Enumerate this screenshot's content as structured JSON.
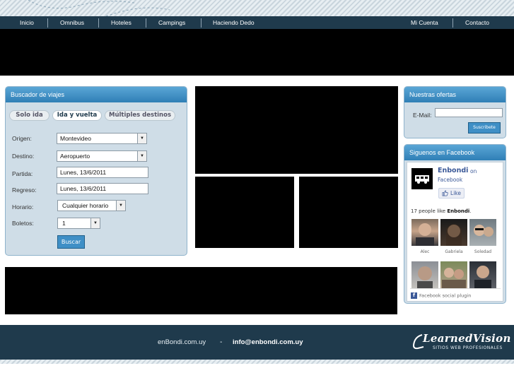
{
  "nav": {
    "items": [
      {
        "label": "Inicio"
      },
      {
        "label": "Omnibus"
      },
      {
        "label": "Hoteles"
      },
      {
        "label": "Campings"
      },
      {
        "label": "Haciendo Dedo"
      }
    ],
    "right_items": [
      {
        "label": "Mi Cuenta"
      },
      {
        "label": "Contacto"
      }
    ]
  },
  "search": {
    "title": "Buscador de viajes",
    "tabs": [
      {
        "label": "Solo ida",
        "active": false
      },
      {
        "label": "Ida y vuelta",
        "active": true
      },
      {
        "label": "Múltiples destinos",
        "active": false
      }
    ],
    "origen": {
      "label": "Origen:",
      "value": "Montevideo"
    },
    "destino": {
      "label": "Destino:",
      "value": "Aeropuerto"
    },
    "partida": {
      "label": "Partida:",
      "value": "Lunes, 13/6/2011"
    },
    "regreso": {
      "label": "Regreso:",
      "value": "Lunes, 13/6/2011"
    },
    "horario": {
      "label": "Horario:",
      "value": "Cualquier horario"
    },
    "boletos": {
      "label": "Boletos:",
      "value": "1"
    },
    "button": "Buscar"
  },
  "offers": {
    "title": "Nuestras ofertas",
    "email_label": "E-Mail:",
    "email_value": "",
    "button": "Suscribete"
  },
  "facebook": {
    "title": "Siguenos en Facebook",
    "page_name": "Enbondi",
    "on_text": "on",
    "facebook_text": "Facebook",
    "like_button": "Like",
    "likes_prefix": "17 people like",
    "likes_page": "Enbondi",
    "likes_suffix": ".",
    "people": [
      {
        "name": "Alec"
      },
      {
        "name": "Gabriela"
      },
      {
        "name": "Soledad"
      },
      {
        "name": ""
      },
      {
        "name": ""
      },
      {
        "name": ""
      }
    ],
    "plugin_text": "Facebook social plugin"
  },
  "footer": {
    "site": "enBondi.com.uy",
    "separator": "-",
    "email": "info@enbondi.com.uy",
    "brand": "LearnedVision",
    "brand_sub": "SITIOS WEB PROFESIONALES"
  },
  "colors": {
    "nav_bg": "#1f3a4c",
    "panel_head": "#2f7fb6",
    "panel_bg": "#cfdde7",
    "facebook_blue": "#3b5998"
  }
}
